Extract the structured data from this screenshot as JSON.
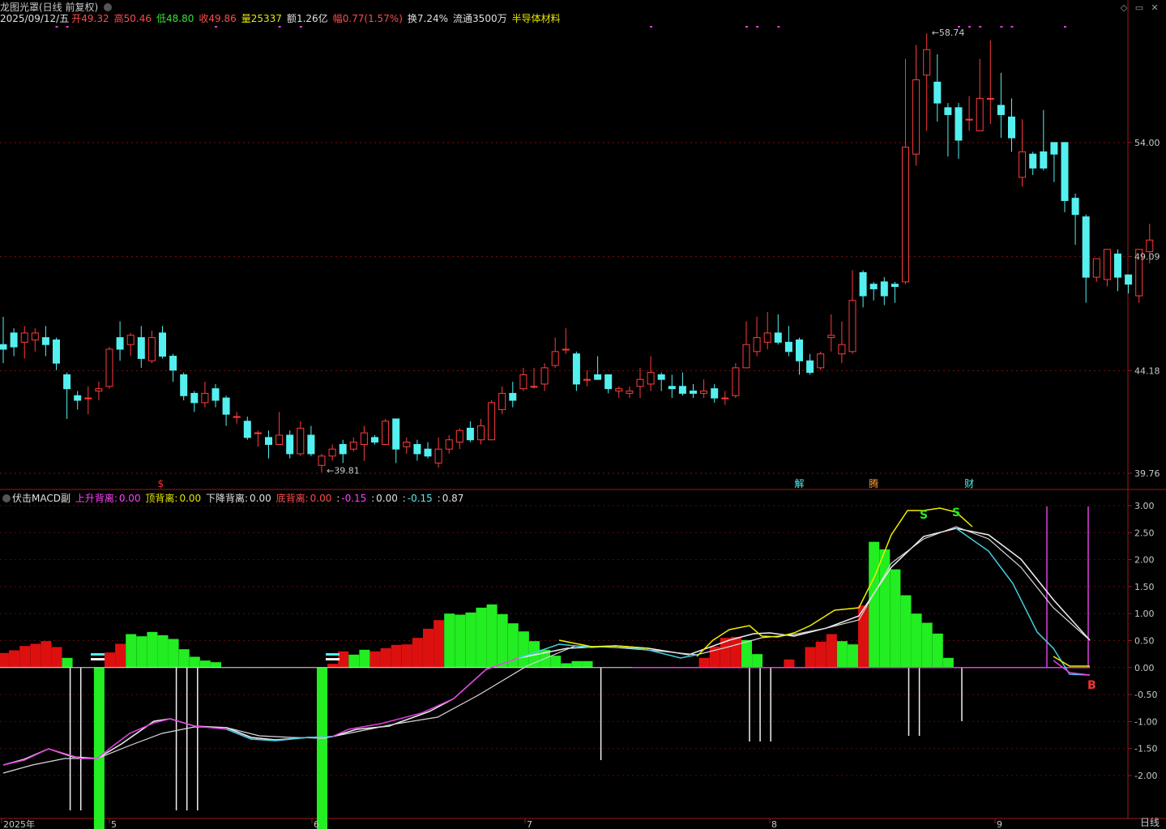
{
  "header": {
    "stock_title": "龙图光罩(日线 前复权)",
    "date": "2025/09/12/五",
    "open_label": "开",
    "open_value": "49.32",
    "high_label": "高",
    "high_value": "50.46",
    "low_label": "低",
    "low_value": "48.80",
    "close_label": "收",
    "close_value": "49.86",
    "volume_label": "量",
    "volume_value": "25337",
    "amount_label": "额",
    "amount_value": "1.26亿",
    "change_label": "幅",
    "change_value": "0.77(1.57%)",
    "turnover_label": "换",
    "turnover_value": "7.24%",
    "float_label": "流通",
    "float_value": "3500万",
    "sector": "半导体材料"
  },
  "price_axis": [
    "54.00",
    "49.09",
    "44.18",
    "39.76"
  ],
  "price_annotations": {
    "high": "58.74",
    "low": "39.81"
  },
  "event_markers": {
    "s": "$",
    "jie": "解",
    "teng": "腾",
    "cai": "财"
  },
  "macd_header": {
    "name": "伏击MACD副",
    "rise_div_label": "上升背离:",
    "rise_div_value": "0.00",
    "top_div_label": "顶背离:",
    "top_div_value": "0.00",
    "fall_div_label": "下降背离:",
    "fall_div_value": "0.00",
    "bottom_div_label": "底背离:",
    "bottom_div_value": "0.00",
    "v1": "-0.15",
    "v2": "0.00",
    "v3": "-0.15",
    "v4": "0.87"
  },
  "macd_axis": [
    "3.00",
    "2.50",
    "2.00",
    "1.50",
    "1.00",
    "0.50",
    "0.00",
    "-0.50",
    "-1.00",
    "-1.50",
    "-2.00"
  ],
  "macd_markers": {
    "s1": "S",
    "s2": "S",
    "b": "B"
  },
  "time_axis": [
    "2025年",
    "5",
    "6",
    "7",
    "8",
    "9"
  ],
  "period_label": "日线",
  "colors": {
    "up": "#ff3c3c",
    "down": "#54f0f0",
    "macd_pos": "#dd1010",
    "macd_neg": "#22ee22",
    "line_white": "#f0f0f0",
    "line_yellow": "#f0f000",
    "line_magenta": "#e040e0",
    "line_cyan": "#40d0e0"
  },
  "chart_data": {
    "type": "candlestick",
    "ylim": [
      39.76,
      58.74
    ],
    "candles": [
      [
        45.3,
        45.1,
        46.5,
        44.5
      ],
      [
        45.8,
        45.2,
        46.0,
        44.8
      ],
      [
        45.4,
        45.8,
        46.1,
        44.7
      ],
      [
        45.5,
        45.8,
        46.0,
        45.0
      ],
      [
        45.6,
        45.3,
        46.1,
        44.8
      ],
      [
        45.5,
        44.5,
        45.6,
        44.2
      ],
      [
        44.0,
        43.4,
        44.1,
        42.1
      ],
      [
        43.1,
        42.9,
        43.3,
        42.5
      ],
      [
        43.0,
        43.0,
        43.5,
        42.3
      ],
      [
        43.3,
        43.4,
        43.7,
        42.9
      ],
      [
        43.5,
        45.1,
        45.2,
        43.4
      ],
      [
        45.6,
        45.1,
        46.3,
        44.6
      ],
      [
        45.3,
        45.7,
        45.8,
        44.8
      ],
      [
        45.6,
        44.7,
        46.1,
        44.3
      ],
      [
        44.6,
        45.6,
        45.9,
        44.5
      ],
      [
        45.8,
        44.8,
        46.1,
        44.7
      ],
      [
        44.8,
        44.2,
        44.9,
        43.7
      ],
      [
        44.0,
        43.1,
        44.1,
        42.9
      ],
      [
        43.2,
        42.8,
        43.3,
        42.4
      ],
      [
        42.8,
        43.2,
        43.7,
        42.6
      ],
      [
        43.4,
        42.9,
        43.6,
        42.6
      ],
      [
        43.0,
        42.3,
        43.1,
        41.8
      ],
      [
        42.2,
        42.2,
        42.4,
        41.9
      ],
      [
        42.0,
        41.3,
        42.2,
        41.2
      ],
      [
        41.5,
        41.5,
        41.6,
        40.9
      ],
      [
        41.3,
        41.0,
        41.6,
        40.4
      ],
      [
        41.0,
        41.4,
        42.4,
        41.0
      ],
      [
        41.4,
        40.6,
        41.6,
        40.4
      ],
      [
        40.6,
        41.7,
        42.0,
        40.5
      ],
      [
        41.4,
        40.6,
        41.8,
        40.5
      ],
      [
        40.1,
        40.5,
        40.6,
        39.8
      ],
      [
        40.5,
        40.8,
        41.0,
        40.3
      ],
      [
        41.0,
        40.6,
        41.2,
        40.2
      ],
      [
        40.8,
        41.1,
        41.3,
        40.7
      ],
      [
        41.0,
        41.5,
        41.8,
        40.3
      ],
      [
        41.3,
        41.1,
        41.4,
        41.0
      ],
      [
        41.0,
        42.0,
        42.1,
        41.0
      ],
      [
        42.1,
        40.8,
        42.1,
        40.2
      ],
      [
        40.9,
        41.1,
        41.3,
        40.6
      ],
      [
        41.0,
        40.6,
        41.2,
        40.3
      ],
      [
        40.8,
        40.5,
        41.1,
        40.4
      ],
      [
        40.2,
        40.8,
        41.3,
        40.0
      ],
      [
        40.8,
        41.2,
        41.4,
        40.6
      ],
      [
        41.1,
        41.6,
        41.7,
        40.8
      ],
      [
        41.7,
        41.2,
        42.0,
        41.1
      ],
      [
        41.2,
        41.8,
        42.1,
        41.0
      ],
      [
        41.2,
        42.8,
        42.9,
        41.2
      ],
      [
        42.5,
        43.2,
        43.5,
        42.3
      ],
      [
        43.2,
        42.9,
        43.7,
        42.6
      ],
      [
        43.4,
        44.0,
        44.3,
        43.3
      ],
      [
        43.5,
        43.5,
        44.3,
        43.4
      ],
      [
        43.6,
        44.3,
        44.5,
        43.3
      ],
      [
        44.4,
        45.0,
        45.6,
        44.3
      ],
      [
        45.1,
        45.1,
        46.0,
        44.9
      ],
      [
        44.9,
        43.6,
        45.0,
        43.3
      ],
      [
        43.8,
        43.8,
        44.2,
        43.5
      ],
      [
        44.0,
        43.8,
        44.8,
        43.8
      ],
      [
        44.0,
        43.4,
        44.0,
        43.2
      ],
      [
        43.3,
        43.4,
        43.5,
        43.0
      ],
      [
        43.2,
        43.3,
        43.5,
        43.0
      ],
      [
        43.5,
        43.8,
        44.3,
        43.0
      ],
      [
        43.6,
        44.1,
        44.8,
        43.3
      ],
      [
        44.0,
        43.8,
        44.1,
        43.3
      ],
      [
        43.5,
        43.4,
        44.0,
        43.0
      ],
      [
        43.5,
        43.2,
        44.1,
        43.1
      ],
      [
        43.3,
        43.2,
        43.6,
        43.0
      ],
      [
        43.2,
        43.3,
        43.8,
        43.0
      ],
      [
        43.4,
        43.0,
        43.6,
        42.8
      ],
      [
        43.0,
        43.0,
        43.3,
        42.7
      ],
      [
        43.1,
        44.3,
        44.5,
        43.0
      ],
      [
        44.3,
        45.3,
        46.3,
        44.3
      ],
      [
        45.0,
        45.6,
        46.5,
        44.8
      ],
      [
        45.4,
        45.8,
        46.7,
        45.1
      ],
      [
        45.8,
        45.4,
        46.6,
        45.3
      ],
      [
        45.4,
        45.0,
        46.1,
        44.8
      ],
      [
        45.5,
        44.6,
        45.6,
        44.0
      ],
      [
        44.6,
        44.1,
        44.9,
        44.0
      ],
      [
        44.3,
        44.9,
        45.0,
        44.2
      ],
      [
        45.6,
        45.7,
        46.6,
        45.0
      ],
      [
        44.9,
        45.3,
        46.3,
        44.5
      ],
      [
        45.0,
        47.2,
        48.5,
        44.9
      ],
      [
        48.4,
        47.4,
        48.5,
        46.9
      ],
      [
        47.9,
        47.7,
        48.0,
        47.2
      ],
      [
        48.0,
        47.4,
        48.2,
        47.0
      ],
      [
        47.9,
        47.8,
        48.0,
        47.1
      ],
      [
        48.0,
        53.8,
        57.6,
        47.9
      ],
      [
        53.5,
        56.7,
        58.2,
        53.0
      ],
      [
        56.9,
        58.0,
        58.7,
        54.5
      ],
      [
        56.6,
        55.7,
        57.8,
        54.9
      ],
      [
        55.5,
        55.2,
        55.7,
        53.4
      ],
      [
        55.5,
        54.1,
        55.7,
        53.3
      ],
      [
        55.0,
        55.0,
        56.0,
        54.5
      ],
      [
        54.5,
        55.9,
        57.6,
        54.5
      ],
      [
        55.9,
        55.9,
        58.4,
        54.8
      ],
      [
        55.6,
        55.2,
        57.0,
        54.2
      ],
      [
        55.1,
        54.2,
        55.9,
        53.6
      ],
      [
        52.5,
        53.6,
        55.0,
        52.1
      ],
      [
        53.5,
        52.9,
        53.6,
        52.6
      ],
      [
        53.6,
        52.9,
        55.4,
        52.8
      ],
      [
        54.0,
        53.5,
        54.0,
        52.3
      ],
      [
        54.0,
        51.5,
        54.0,
        51.0
      ],
      [
        51.6,
        50.9,
        51.8,
        49.6
      ],
      [
        50.8,
        48.2,
        50.9,
        47.1
      ],
      [
        48.2,
        49.0,
        49.0,
        48.0
      ],
      [
        48.1,
        49.4,
        49.4,
        47.8
      ],
      [
        49.2,
        48.2,
        49.4,
        47.6
      ],
      [
        48.3,
        47.9,
        48.3,
        47.5
      ],
      [
        47.4,
        49.4,
        49.4,
        47.1
      ],
      [
        49.3,
        49.8,
        50.5,
        48.8
      ]
    ],
    "macd": {
      "hist": [
        0.27,
        0.32,
        0.4,
        0.44,
        0.49,
        0.38,
        0.18,
        0.0,
        0.0,
        -2.7,
        0.28,
        0.44,
        0.62,
        0.58,
        0.66,
        0.6,
        0.53,
        0.34,
        0.2,
        0.13,
        0.1,
        0.0,
        0.0,
        0.0,
        0.0,
        0.0,
        0.0,
        0.0,
        0.0,
        0.0,
        -2.7,
        0.07,
        0.3,
        0.24,
        0.33,
        0.3,
        0.36,
        0.42,
        0.43,
        0.55,
        0.72,
        0.88,
        1.0,
        0.98,
        1.02,
        1.11,
        1.17,
        0.99,
        0.82,
        0.67,
        0.49,
        0.33,
        0.22,
        0.08,
        0.12,
        0.12,
        0.0,
        0.0,
        0.0,
        0.0,
        0.0,
        0.0,
        0.0,
        0.0,
        0.0,
        0.0,
        0.18,
        0.39,
        0.55,
        0.57,
        0.51,
        0.25,
        0.0,
        0.0,
        0.15,
        0.0,
        0.38,
        0.48,
        0.62,
        0.49,
        0.43,
        1.15,
        2.33,
        2.19,
        1.82,
        1.34,
        1.0,
        0.83,
        0.63,
        0.18,
        0.0,
        0.0,
        0.0,
        0.0,
        0.0,
        0.0,
        0.0,
        0.0,
        0.0,
        0.0,
        0.0,
        0.0,
        0.0,
        0.0,
        0.0,
        0.0,
        0.0,
        0.0,
        0.0,
        0.0,
        0.0
      ],
      "hist_sign": "per-bar"
    }
  }
}
